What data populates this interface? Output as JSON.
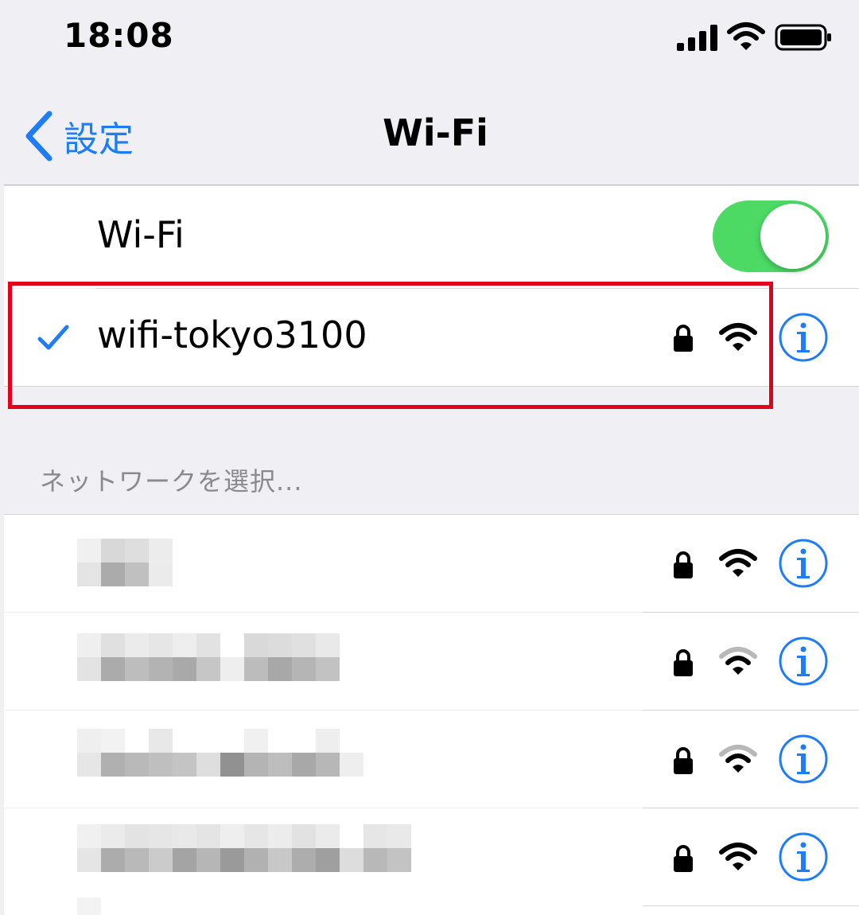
{
  "status_bar": {
    "time": "18:08",
    "icons": [
      "cellular-signal-icon",
      "wifi-signal-icon",
      "battery-icon"
    ]
  },
  "nav": {
    "back_label": "設定",
    "title": "Wi-Fi"
  },
  "wifi_toggle": {
    "label": "Wi-Fi",
    "enabled": true
  },
  "connected_network": {
    "name": "wifi-tokyo3100",
    "secured": true,
    "signal": "full",
    "checked": true
  },
  "section_header": "ネットワークを選択...",
  "networks": [
    {
      "name_redacted": true,
      "secured": true,
      "signal": "full"
    },
    {
      "name_redacted": true,
      "secured": true,
      "signal": "medium"
    },
    {
      "name_redacted": true,
      "secured": true,
      "signal": "medium"
    },
    {
      "name_redacted": true,
      "secured": true,
      "signal": "full"
    }
  ],
  "colors": {
    "accent": "#1e7cf5",
    "switch_on": "#4cd964",
    "highlight": "#e3001b",
    "background": "#efeff4"
  }
}
